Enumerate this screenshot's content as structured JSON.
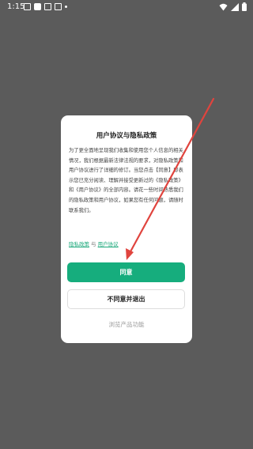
{
  "status_bar": {
    "time": "1:15",
    "left_icons": [
      "image-icon",
      "app-icon",
      "download-icon",
      "security-icon",
      "dot-icon"
    ],
    "right_icons": [
      "wifi-icon",
      "signal-icon",
      "battery-icon"
    ]
  },
  "dialog": {
    "title": "用户协议与隐私政策",
    "body": "为了更全面地呈现我们收集和使用您个人信息的相关情况，我们根据最新法律法规的要求，对隐私政策和用户协议进行了详细的修订。当您点击【同意】即表示您已充分阅读、理解并接受更新过的《隐私政策》和《用户协议》的全部内容。请花一些时间熟悉我们的隐私政策和用户协议，如果您有任何问题，请随时联系我们。",
    "privacy_link": "隐私政策",
    "and_text": "与",
    "terms_link": "用户协议",
    "agree_label": "同意",
    "disagree_label": "不同意并退出",
    "browse_label": "浏览产品功能"
  },
  "colors": {
    "overlay": "#5b5b5b",
    "accent": "#16ad7d",
    "arrow": "#e0443e"
  }
}
